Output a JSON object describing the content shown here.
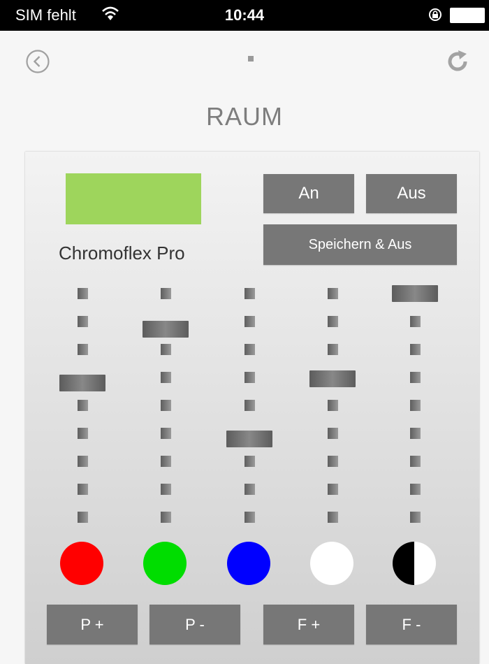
{
  "status_bar": {
    "carrier": "SIM fehlt",
    "wifi_icon": "wifi-icon",
    "time": "10:44",
    "lock_icon": "rotation-lock-icon",
    "battery_icon": "battery-icon"
  },
  "nav": {
    "back_icon": "back-circle-icon",
    "refresh_icon": "refresh-icon"
  },
  "page": {
    "title": "RAUM"
  },
  "device": {
    "name": "Chromoflex Pro",
    "current_color": "#9ed55c"
  },
  "buttons": {
    "on": "An",
    "off": "Aus",
    "save_off": "Speichern & Aus"
  },
  "sliders": [
    {
      "channel": "red",
      "level": 0.6
    },
    {
      "channel": "green",
      "level": 0.84
    },
    {
      "channel": "blue",
      "level": 0.35
    },
    {
      "channel": "white",
      "level": 0.62
    },
    {
      "channel": "brightness",
      "level": 1.0
    }
  ],
  "color_circles": [
    {
      "name": "red",
      "color": "#ff0000"
    },
    {
      "name": "green",
      "color": "#00dd00"
    },
    {
      "name": "blue",
      "color": "#0000ff"
    },
    {
      "name": "white",
      "color": "#ffffff"
    },
    {
      "name": "black-white",
      "color": "#000000"
    }
  ],
  "bottom_buttons": {
    "p_plus": "P +",
    "p_minus": "P -",
    "f_plus": "F +",
    "f_minus": "F -"
  }
}
